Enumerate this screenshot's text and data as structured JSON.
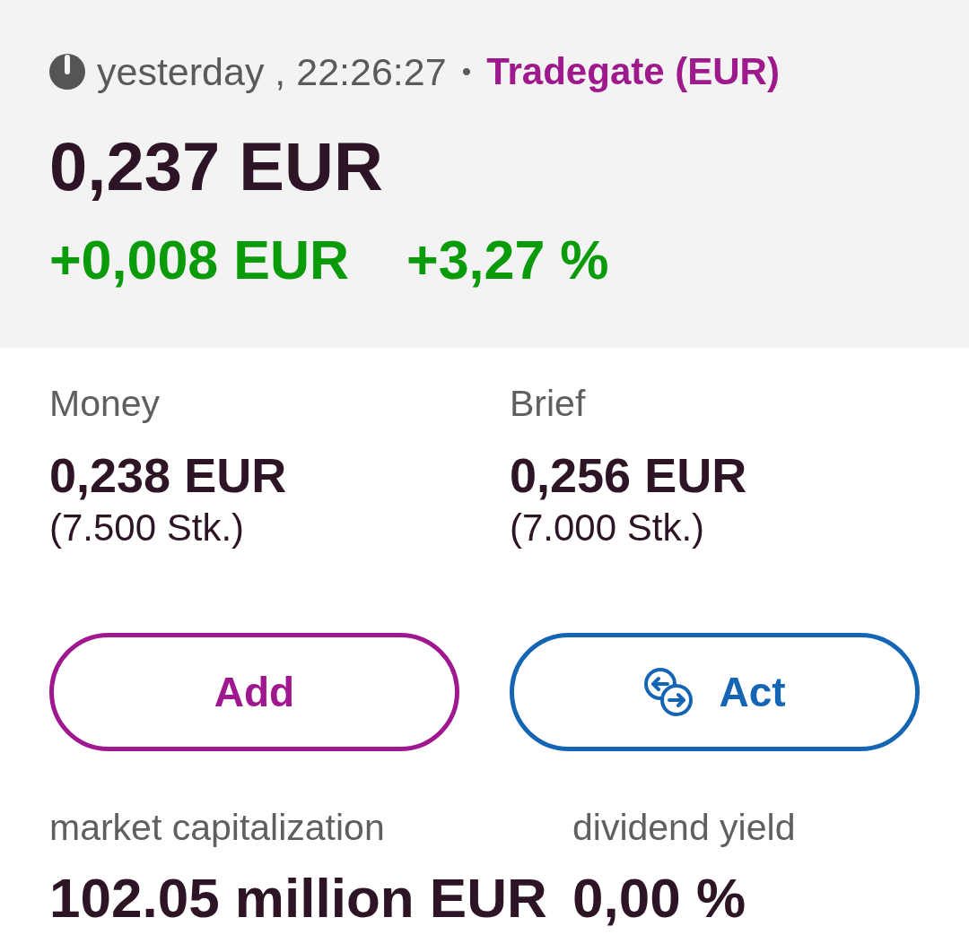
{
  "quote_header": {
    "timestamp": "yesterday , 22:26:27",
    "separator": "•",
    "exchange": "Tradegate (EUR)",
    "price": "0,237 EUR",
    "change_absolute": "+0,008 EUR",
    "change_percent": "+3,27 %"
  },
  "order_book": [
    {
      "label": "Money",
      "price": "0,238 EUR",
      "quantity": "(7.500 Stk.)"
    },
    {
      "label": "Brief",
      "price": "0,256 EUR",
      "quantity": "(7.000 Stk.)"
    }
  ],
  "buttons": [
    {
      "label": "Add",
      "kind": "watchlist",
      "color": "#a0188f"
    },
    {
      "label": "Act",
      "kind": "trade",
      "color": "#1565b5"
    }
  ],
  "key_figures": [
    {
      "label": "market capitalization",
      "value": "102.05 million EUR"
    },
    {
      "label": "dividend yield",
      "value": "0,00 %"
    }
  ]
}
